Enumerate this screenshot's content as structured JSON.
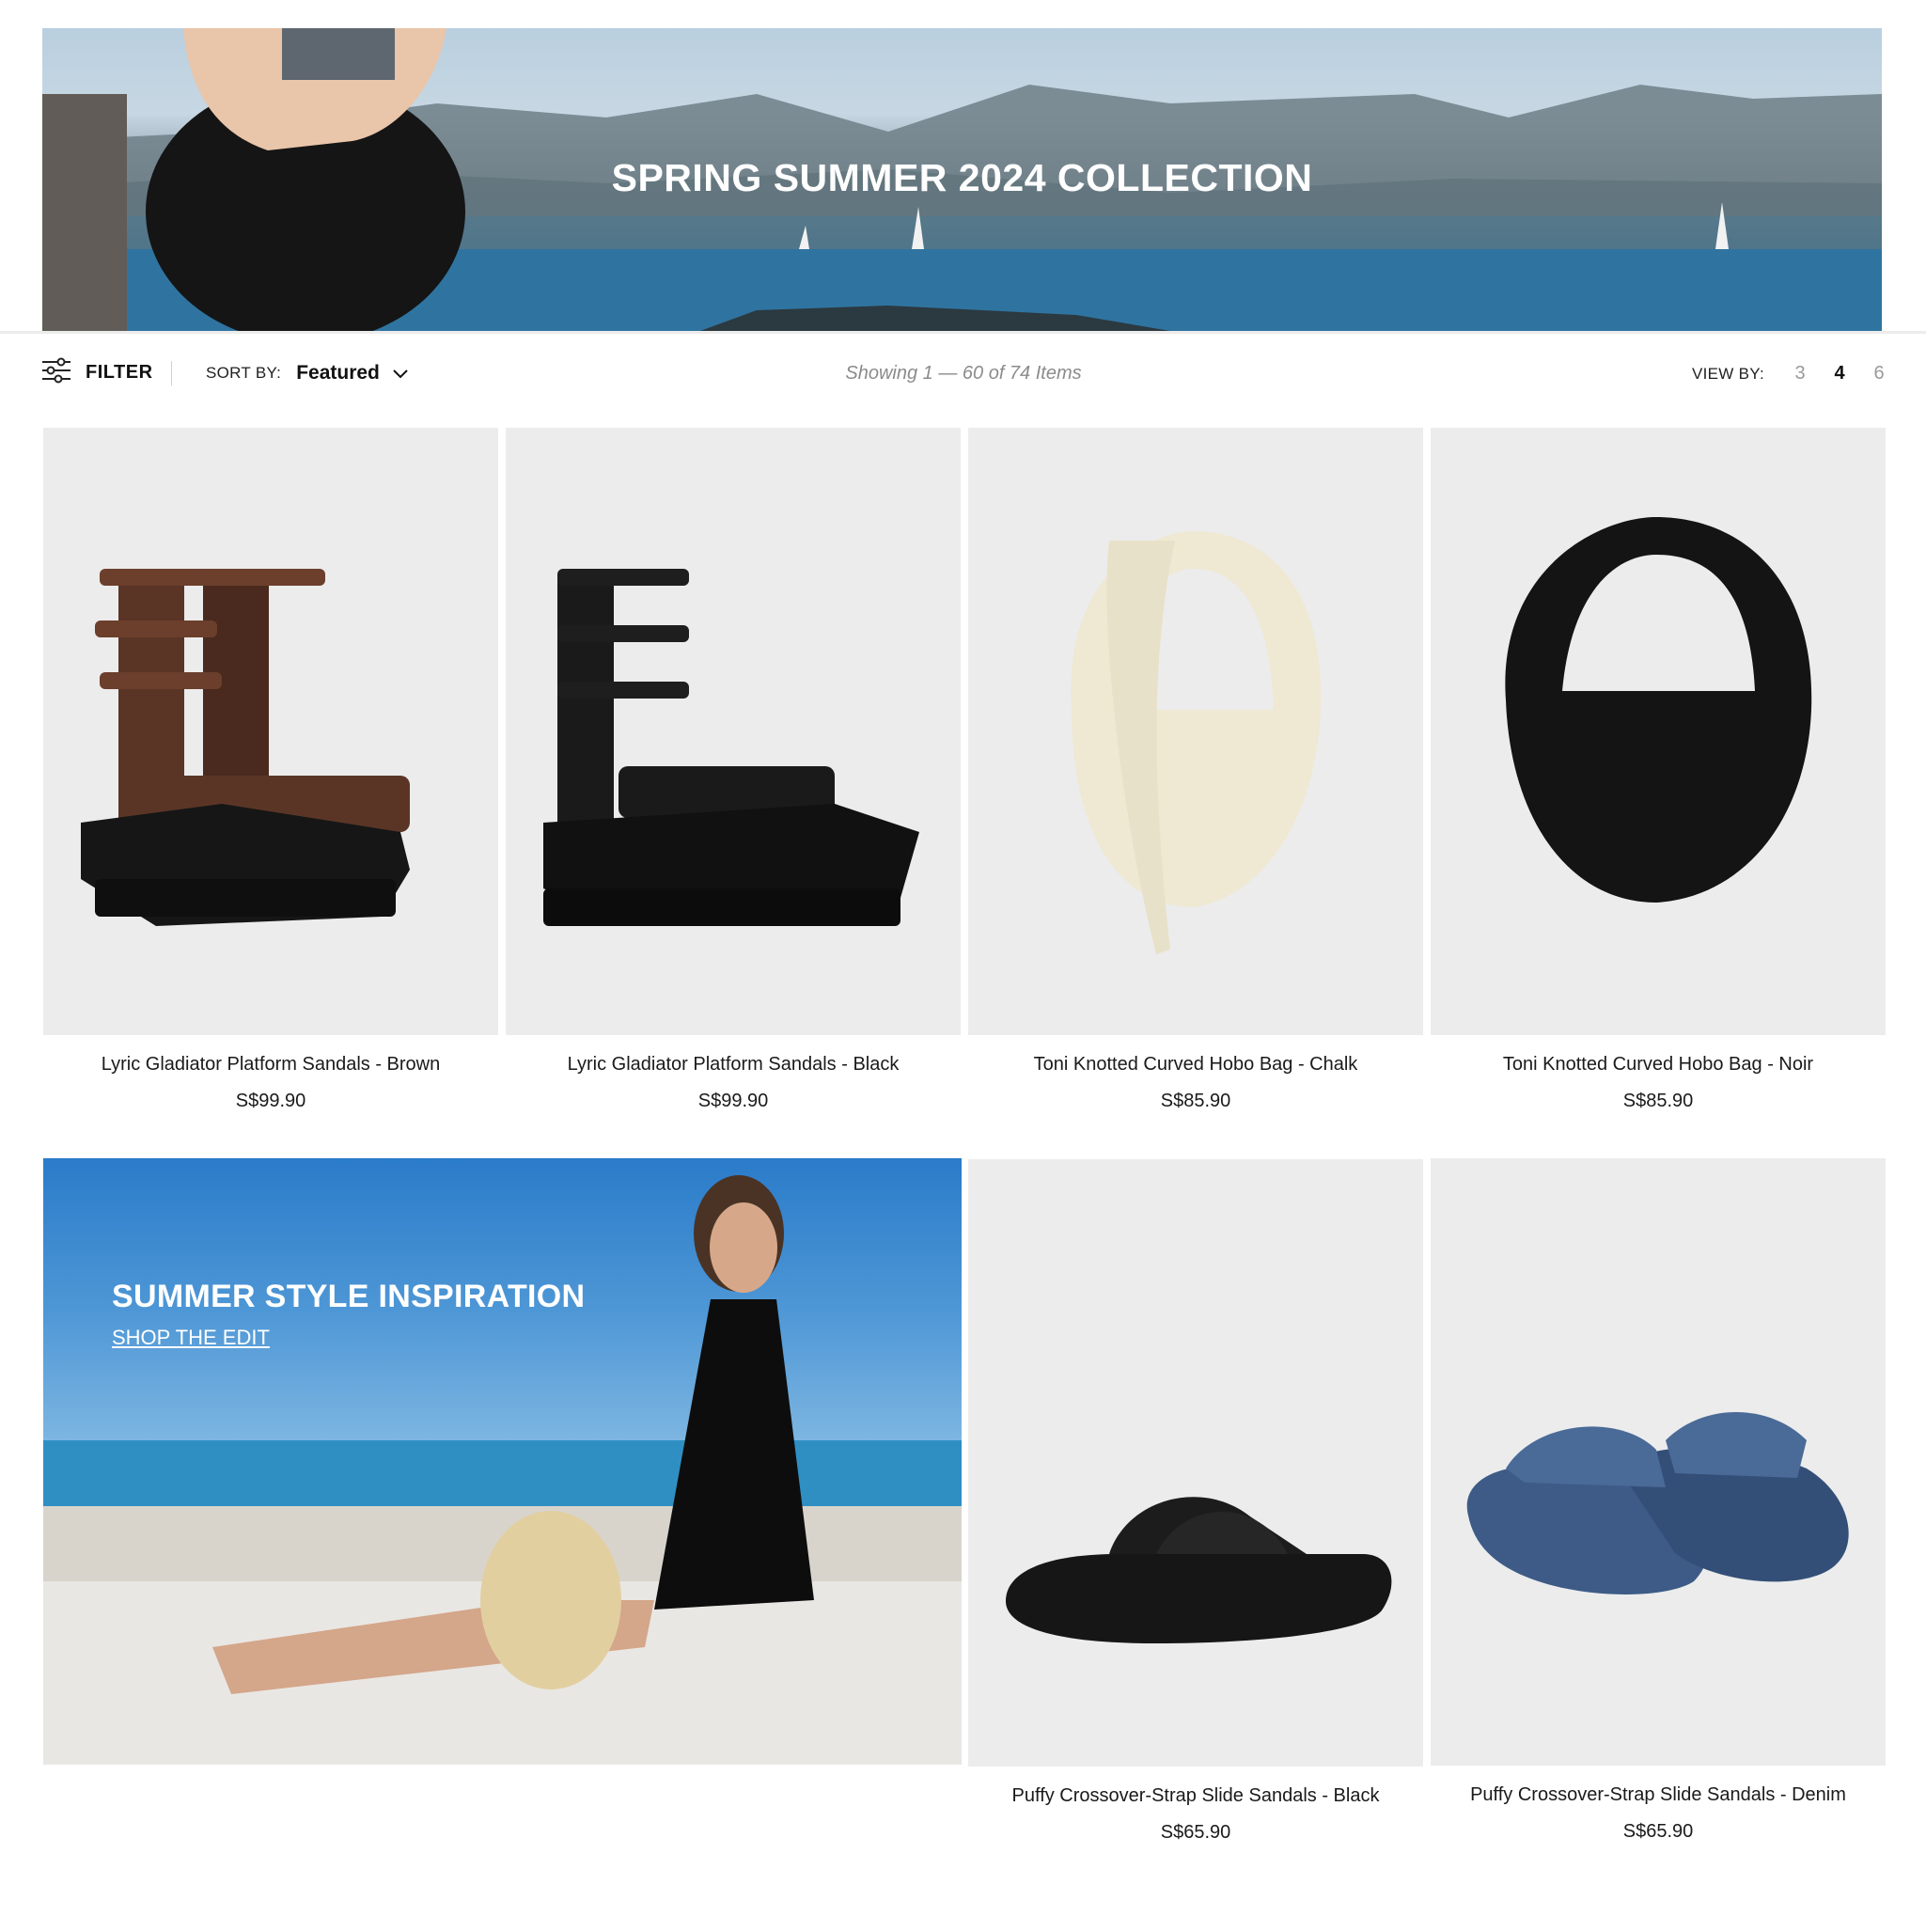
{
  "hero": {
    "title": "SPRING SUMMER 2024 COLLECTION"
  },
  "toolbar": {
    "filter_label": "FILTER",
    "sort_label": "SORT BY:",
    "sort_value": "Featured",
    "showing_text": "Showing 1 — 60 of 74 Items",
    "viewby_label": "VIEW BY:",
    "view_options": [
      "3",
      "4",
      "6"
    ],
    "view_selected": "4"
  },
  "products": [
    {
      "name": "Lyric Gladiator Platform Sandals - Brown",
      "price": "S$99.90"
    },
    {
      "name": "Lyric Gladiator Platform Sandals - Black",
      "price": "S$99.90"
    },
    {
      "name": "Toni Knotted Curved Hobo Bag - Chalk",
      "price": "S$85.90"
    },
    {
      "name": "Toni Knotted Curved Hobo Bag - Noir",
      "price": "S$85.90"
    },
    {
      "name": "Puffy Crossover-Strap Slide Sandals - Black",
      "price": "S$65.90"
    },
    {
      "name": "Puffy Crossover-Strap Slide Sandals - Denim",
      "price": "S$65.90"
    }
  ],
  "promo": {
    "title": "SUMMER STYLE INSPIRATION",
    "link": "SHOP THE EDIT"
  }
}
